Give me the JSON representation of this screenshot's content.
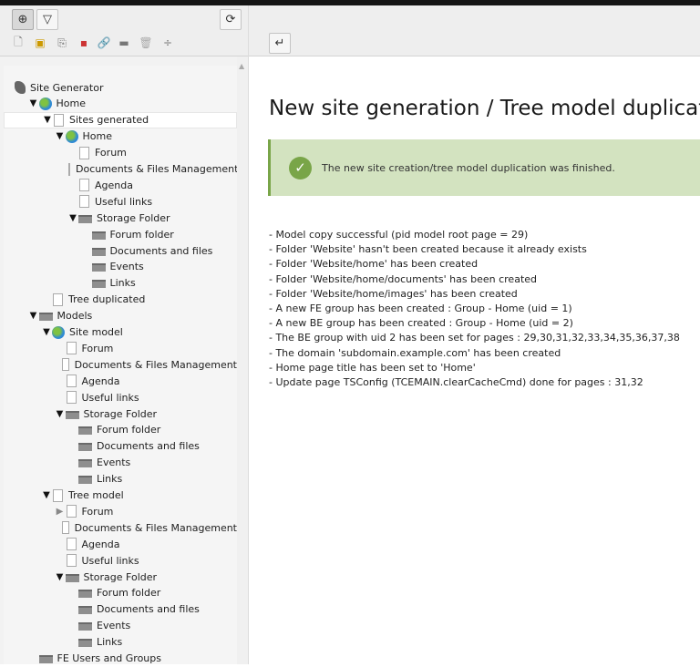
{
  "toolbar": {
    "new_page_icon": "new-page-icon",
    "filter_icon": "filter-icon",
    "refresh_icon": "refresh-icon",
    "return_icon": "return-icon",
    "small_icons": [
      "page-icon",
      "page-user-icon",
      "page-shortcut-icon",
      "page-mountpoint-icon",
      "link-icon",
      "folder-icon",
      "trash-icon",
      "divider-icon"
    ]
  },
  "tree": [
    {
      "label": "Site Generator",
      "depth": 0,
      "icon": "logo",
      "toggle": "none"
    },
    {
      "label": "Home",
      "depth": 1,
      "icon": "globe",
      "toggle": "open"
    },
    {
      "label": "Sites generated",
      "depth": 2,
      "icon": "page",
      "toggle": "open",
      "highlighted": true
    },
    {
      "label": "Home",
      "depth": 3,
      "icon": "globe",
      "toggle": "open"
    },
    {
      "label": "Forum",
      "depth": 4,
      "icon": "page",
      "toggle": "none"
    },
    {
      "label": "Documents & Files Management",
      "depth": 4,
      "icon": "page",
      "toggle": "none"
    },
    {
      "label": "Agenda",
      "depth": 4,
      "icon": "page",
      "toggle": "none"
    },
    {
      "label": "Useful links",
      "depth": 4,
      "icon": "page",
      "toggle": "none"
    },
    {
      "label": "Storage Folder",
      "depth": 4,
      "icon": "folder",
      "toggle": "open"
    },
    {
      "label": "Forum folder",
      "depth": 5,
      "icon": "folder",
      "toggle": "none"
    },
    {
      "label": "Documents and files",
      "depth": 5,
      "icon": "folder",
      "toggle": "none"
    },
    {
      "label": "Events",
      "depth": 5,
      "icon": "folder",
      "toggle": "none"
    },
    {
      "label": "Links",
      "depth": 5,
      "icon": "folder",
      "toggle": "none"
    },
    {
      "label": "Tree duplicated",
      "depth": 2,
      "icon": "page",
      "toggle": "none"
    },
    {
      "label": "Models",
      "depth": 1,
      "icon": "folder",
      "toggle": "open"
    },
    {
      "label": "Site model",
      "depth": 2,
      "icon": "globe",
      "toggle": "open"
    },
    {
      "label": "Forum",
      "depth": 3,
      "icon": "page",
      "toggle": "none"
    },
    {
      "label": "Documents & Files Management",
      "depth": 3,
      "icon": "page",
      "toggle": "none"
    },
    {
      "label": "Agenda",
      "depth": 3,
      "icon": "page",
      "toggle": "none"
    },
    {
      "label": "Useful links",
      "depth": 3,
      "icon": "page",
      "toggle": "none"
    },
    {
      "label": "Storage Folder",
      "depth": 3,
      "icon": "folder",
      "toggle": "open"
    },
    {
      "label": "Forum folder",
      "depth": 4,
      "icon": "folder",
      "toggle": "none"
    },
    {
      "label": "Documents and files",
      "depth": 4,
      "icon": "folder",
      "toggle": "none"
    },
    {
      "label": "Events",
      "depth": 4,
      "icon": "folder",
      "toggle": "none"
    },
    {
      "label": "Links",
      "depth": 4,
      "icon": "folder",
      "toggle": "none"
    },
    {
      "label": "Tree model",
      "depth": 2,
      "icon": "page",
      "toggle": "open"
    },
    {
      "label": "Forum",
      "depth": 3,
      "icon": "page",
      "toggle": "closed"
    },
    {
      "label": "Documents & Files Management",
      "depth": 3,
      "icon": "page",
      "toggle": "none"
    },
    {
      "label": "Agenda",
      "depth": 3,
      "icon": "page",
      "toggle": "none"
    },
    {
      "label": "Useful links",
      "depth": 3,
      "icon": "page",
      "toggle": "none"
    },
    {
      "label": "Storage Folder",
      "depth": 3,
      "icon": "folder",
      "toggle": "open"
    },
    {
      "label": "Forum folder",
      "depth": 4,
      "icon": "folder",
      "toggle": "none"
    },
    {
      "label": "Documents and files",
      "depth": 4,
      "icon": "folder",
      "toggle": "none"
    },
    {
      "label": "Events",
      "depth": 4,
      "icon": "folder",
      "toggle": "none"
    },
    {
      "label": "Links",
      "depth": 4,
      "icon": "folder",
      "toggle": "none"
    },
    {
      "label": "FE Users and Groups",
      "depth": 1,
      "icon": "folder",
      "toggle": "none"
    }
  ],
  "main": {
    "title": "New site generation / Tree model duplicator",
    "alert": {
      "message": "The new site creation/tree model duplication was finished.",
      "color": "#79a548",
      "background": "#d3e3c0"
    },
    "log": [
      "- Model copy successful (pid model root page = 29)",
      "- Folder 'Website' hasn't been created because it already exists",
      "- Folder 'Website/home' has been created",
      "- Folder 'Website/home/documents' has been created",
      "- Folder 'Website/home/images' has been created",
      "- A new FE group has been created : Group - Home (uid = 1)",
      "- A new BE group has been created : Group - Home (uid = 2)",
      "- The BE group with uid 2 has been set for pages : 29,30,31,32,33,34,35,36,37,38",
      "- The domain 'subdomain.example.com' has been created",
      "- Home page title has been set to 'Home'",
      "- Update page TSConfig (TCEMAIN.clearCacheCmd) done for pages : 31,32"
    ]
  }
}
